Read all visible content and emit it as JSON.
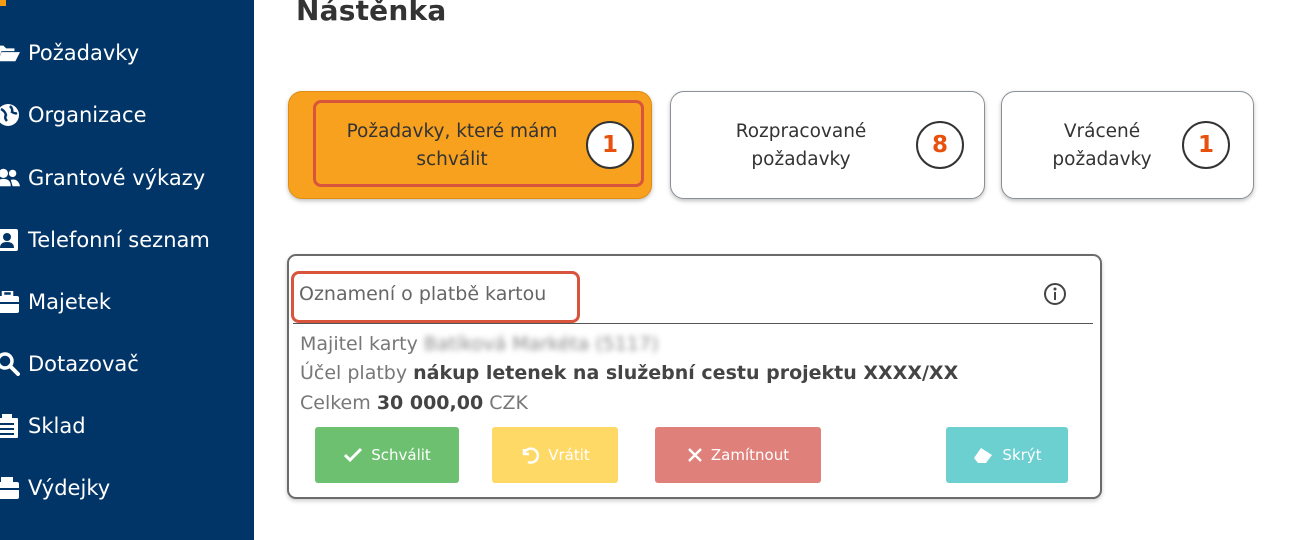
{
  "sidebar": {
    "items": [
      {
        "label": "Požadavky",
        "icon": "folder-open-icon"
      },
      {
        "label": "Organizace",
        "icon": "globe-icon"
      },
      {
        "label": "Grantové výkazy",
        "icon": "users-icon"
      },
      {
        "label": "Telefonní seznam",
        "icon": "address-card-icon"
      },
      {
        "label": "Majetek",
        "icon": "suitcase-icon"
      },
      {
        "label": "Dotazovač",
        "icon": "search-icon"
      },
      {
        "label": "Sklad",
        "icon": "warehouse-icon"
      },
      {
        "label": "Výdejky",
        "icon": "truck-icon"
      }
    ]
  },
  "page": {
    "title": "Nástěnka"
  },
  "tiles": [
    {
      "label": "Požadavky, které mám schválit",
      "count": "1",
      "color": "#f7a11f"
    },
    {
      "label": "Rozpracované požadavky",
      "count": "8",
      "color": "#ffffff"
    },
    {
      "label": "Vrácené požadavky",
      "count": "1",
      "color": "#ffffff"
    }
  ],
  "card": {
    "title": "Oznamení o platbě kartou",
    "owner_label": "Majitel karty",
    "owner_value": "Batíková Markéta (5117)",
    "purpose_label": "Účel platby",
    "purpose_value": "nákup letenek na služební cestu projektu XXXX/XX",
    "total_label": "Celkem",
    "total_value": "30 000,00",
    "currency": "CZK",
    "buttons": {
      "approve": "Schválit",
      "return": "Vrátit",
      "reject": "Zamítnout",
      "hide": "Skrýt"
    }
  },
  "colors": {
    "sidebar": "#023567",
    "accent": "#f7a11f",
    "highlight": "#d9543c",
    "badge_number": "#e8500e"
  }
}
